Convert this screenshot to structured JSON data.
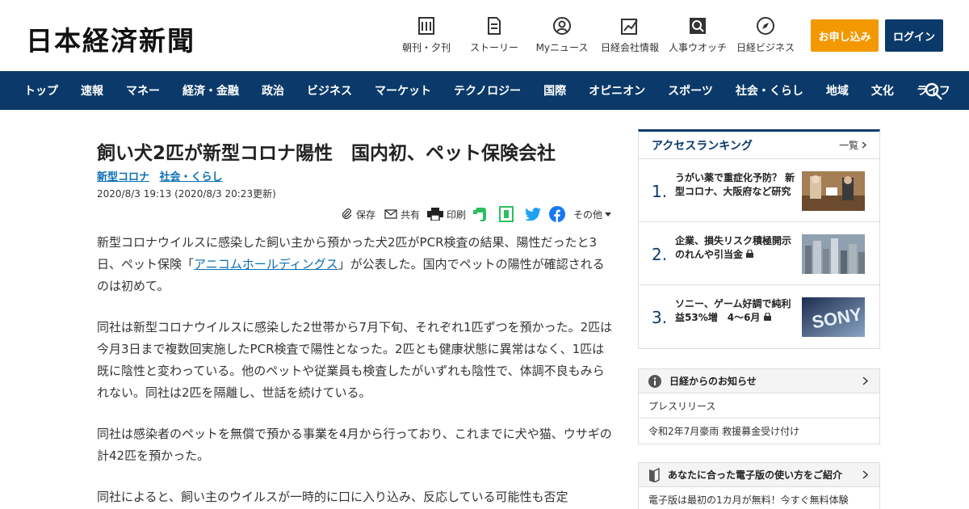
{
  "header": {
    "logo": "日本経済新聞",
    "utilities": [
      {
        "label": "朝刊・夕刊",
        "icon": "newspaper-icon"
      },
      {
        "label": "ストーリー",
        "icon": "story-icon"
      },
      {
        "label": "Myニュース",
        "icon": "user-icon"
      },
      {
        "label": "日経会社情報",
        "icon": "chart-icon"
      },
      {
        "label": "人事ウオッチ",
        "icon": "search-person-icon"
      },
      {
        "label": "日経ビジネス",
        "icon": "compass-icon"
      }
    ],
    "subscribe_label": "お申し込み",
    "login_label": "ログイン"
  },
  "nav": {
    "items": [
      "トップ",
      "速報",
      "マネー",
      "経済・金融",
      "政治",
      "ビジネス",
      "マーケット",
      "テクノロジー",
      "国際",
      "オピニオン",
      "スポーツ",
      "社会・くらし",
      "地域",
      "文化",
      "ライフ"
    ]
  },
  "article": {
    "title": "飼い犬2匹が新型コロナ陽性　国内初、ペット保険会社",
    "tags": [
      "新型コロナ",
      "社会・くらし"
    ],
    "date": "2020/8/3 19:13 (2020/8/3 20:23更新)",
    "share": {
      "save": "保存",
      "share": "共有",
      "print": "印刷",
      "more": "その他"
    },
    "p1_before": "新型コロナウイルスに感染した飼い主から預かった犬2匹がPCR検査の結果、陽性だったと3日、ペット保険「",
    "p1_link": "アニコムホールディングス",
    "p1_after": "」が公表した。国内でペットの陽性が確認されるのは初めて。",
    "p2": "同社は新型コロナウイルスに感染した2世帯から7月下旬、それぞれ1匹ずつを預かった。2匹は今月3日まで複数回実施したPCR検査で陽性となった。2匹とも健康状態に異常はなく、1匹は既に陰性と変わっている。他のペットや従業員も検査したがいずれも陰性で、体調不良もみられない。同社は2匹を隔離し、世話を続けている。",
    "p3": "同社は感染者のペットを無償で預かる事業を4月から行っており、これまでに犬や猫、ウサギの計42匹を預かった。",
    "p4": "同社によると、飼い主のウイルスが一時的に口に入り込み、反応している可能性も否定"
  },
  "ranking": {
    "heading": "アクセスランキング",
    "more": "一覧",
    "items": [
      {
        "rank": "1.",
        "text": "うがい薬で重症化予防？ 新型コロナ、大阪府など研究",
        "locked": false
      },
      {
        "rank": "2.",
        "text": "企業、損失リスク積極開示　のれんや引当金",
        "locked": true
      },
      {
        "rank": "3.",
        "text": "ソニー、ゲーム好調で純利益53%増　4～6月",
        "locked": true
      }
    ],
    "sony_logo": "SONY"
  },
  "notices": {
    "heading": "日経からのお知らせ",
    "items": [
      "プレスリリース",
      "令和2年7月豪雨 救援募金受け付け"
    ]
  },
  "guide": {
    "heading": "あなたに合った電子版の使い方をご紹介",
    "items": [
      "電子版は最初の1カ月が無料！今すぐ無料体験"
    ]
  },
  "colors": {
    "navy": "#0b3a6a",
    "orange": "#f39800",
    "link": "#0b6eb5"
  }
}
